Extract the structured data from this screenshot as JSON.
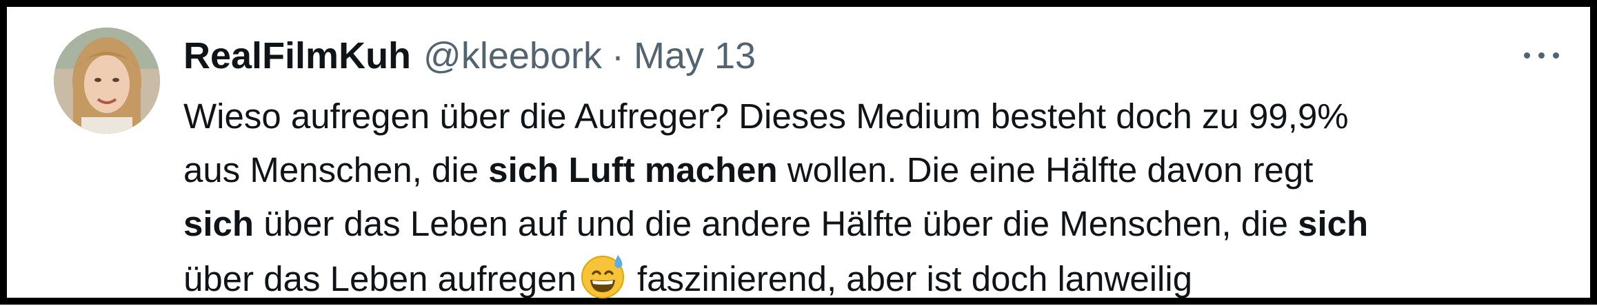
{
  "tweet": {
    "author_name": "RealFilmKuh",
    "handle": "@kleebork",
    "separator": "·",
    "date": "May 13",
    "more_icon": "more-horizontal-icon",
    "emoji": "grinning-face-with-sweat-emoji",
    "text": {
      "l1": "Wieso aufregen über die Aufreger? Dieses Medium besteht doch zu 99,9%",
      "l2_a": "aus Menschen, die ",
      "l2_b": "sich Luft machen",
      "l2_c": " wollen. Die eine Hälfte davon regt",
      "l3_a": "sich",
      "l3_b": " über das Leben auf und die andere Hälfte über die Menschen, die ",
      "l3_c": "sich",
      "l4_a": "über das Leben aufregen",
      "l4_b": "faszinierend, aber ist doch lanweilig"
    }
  }
}
